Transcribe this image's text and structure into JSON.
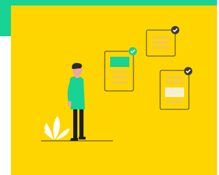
{
  "colors": {
    "background": "#ffffff",
    "accent": "#17d394",
    "panel": "#ffd500",
    "card_outline": "#3b3b3b",
    "card_line": "#f2c84b",
    "highlight_green": "#17d394",
    "highlight_light": "#f5f0d5",
    "check_green": "#17d394",
    "check_dark": "#3b3b3b",
    "shirt": "#17d394",
    "pants": "#1f1f1f",
    "skin": "#f0a898",
    "hair": "#2b2b2b",
    "plant": "#ffffff"
  },
  "icons": {
    "card_left_badge": "check-icon",
    "card_top_badge": "check-icon",
    "card_right_badge": "check-icon"
  }
}
